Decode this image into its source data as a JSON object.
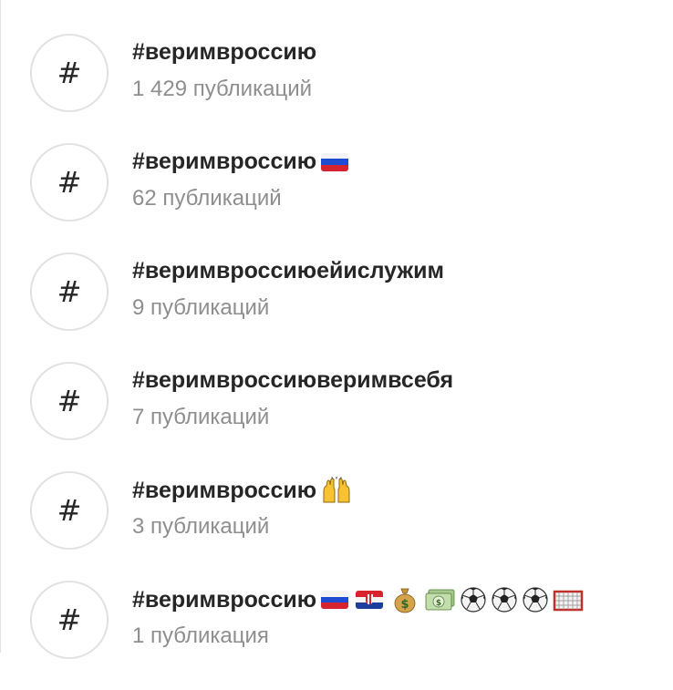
{
  "results": [
    {
      "tag": "#веримвроссию",
      "count": "1 429 публикаций",
      "emojis": []
    },
    {
      "tag": "#веримвроссию",
      "count": "62 публикаций",
      "emojis": [
        "flag-russia-icon"
      ]
    },
    {
      "tag": "#веримвроссиюейислужим",
      "count": "9 публикаций",
      "emojis": []
    },
    {
      "tag": "#веримвроссиюверимвсебя",
      "count": "7 публикаций",
      "emojis": []
    },
    {
      "tag": "#веримвроссию",
      "count": "3 публикаций",
      "emojis": [
        "raising-hands-icon"
      ]
    },
    {
      "tag": "#веримвроссию",
      "count": "1 публикация",
      "emojis": [
        "flag-russia-icon",
        "flag-croatia-icon",
        "money-bag-icon",
        "dollar-banknote-icon",
        "soccer-ball-icon",
        "soccer-ball-icon",
        "soccer-ball-icon",
        "goal-net-icon"
      ]
    }
  ],
  "hash_symbol": "#",
  "colors": {
    "tag_text": "#262626",
    "count_text": "#8e8e8e",
    "circle_border": "#e2e2e2"
  }
}
